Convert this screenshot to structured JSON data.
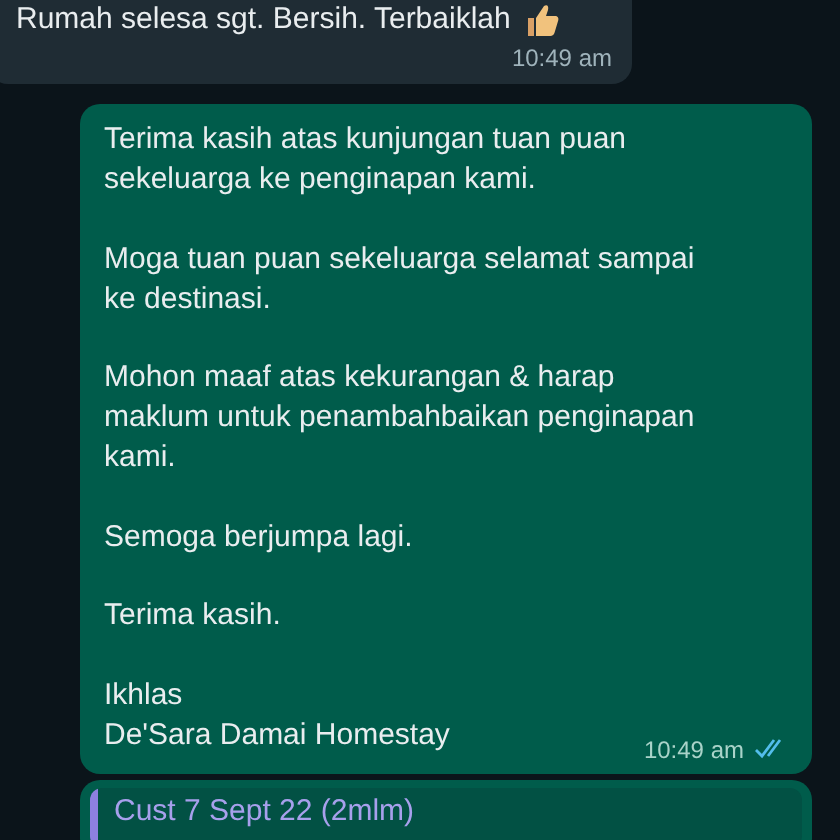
{
  "messages": [
    {
      "kind": "incoming",
      "paragraphs": [
        "Rumah selesa sgt. Bersih. Terbaiklah"
      ],
      "thumb_icon": true,
      "time": "10:49 am"
    },
    {
      "kind": "outgoing",
      "paragraphs": [
        "Terima kasih atas kunjungan tuan puan sekeluarga ke penginapan kami.",
        "Moga tuan puan sekeluarga selamat sampai ke destinasi.",
        "Mohon maaf atas kekurangan & harap maklum untuk penambahbaikan penginapan kami.",
        "Semoga berjumpa lagi.",
        "Terima kasih.",
        "Ikhlas\nDe'Sara Damai Homestay"
      ],
      "time": "10:49 am",
      "read": true
    },
    {
      "kind": "outgoing",
      "quote": "Cust 7 Sept 22 (2mlm)"
    }
  ]
}
